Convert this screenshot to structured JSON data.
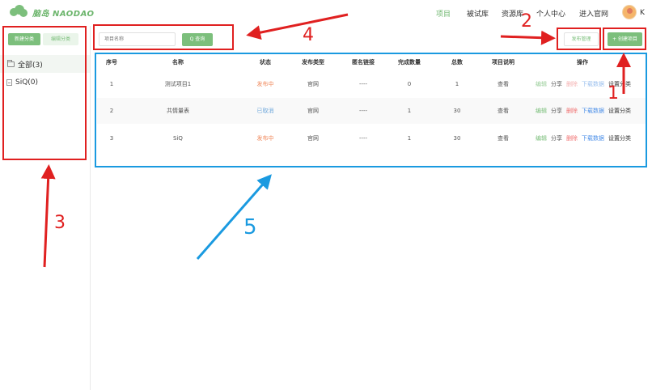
{
  "header": {
    "brand": "脑岛 NAODAO",
    "nav": [
      {
        "label": "项目",
        "active": true
      },
      {
        "label": "被试库"
      },
      {
        "label": "资源库"
      },
      {
        "label": "个人中心"
      },
      {
        "label": "进入官网"
      }
    ],
    "user_initial": "K"
  },
  "sidebar": {
    "new_category": "新建分类",
    "edit_category": "编辑分类",
    "items": [
      {
        "label": "全部(3)",
        "icon": "folder-icon",
        "active": true
      },
      {
        "label": "SiQ(0)",
        "icon": "document-icon"
      }
    ]
  },
  "toolbar": {
    "search_placeholder": "项目名称",
    "search_button": "Q 查询",
    "publish_manage": "发布管理",
    "create_project": "+ 创建项目"
  },
  "table": {
    "headers": [
      "序号",
      "名称",
      "状态",
      "发布类型",
      "匿名链接",
      "完成数量",
      "总数",
      "项目说明",
      "操作"
    ],
    "rows": [
      {
        "index": "1",
        "name": "测试项目1",
        "status": "发布中",
        "status_kind": "published",
        "type": "官网",
        "link": "----",
        "done": "0",
        "total": "1",
        "desc": "查看",
        "ops": [
          "编辑",
          "分享",
          "删除",
          "下载数据",
          "设置分类"
        ],
        "faded": true
      },
      {
        "index": "2",
        "name": "共情量表",
        "status": "已取消",
        "status_kind": "cancelled",
        "type": "官网",
        "link": "----",
        "done": "1",
        "total": "30",
        "desc": "查看",
        "ops": [
          "编辑",
          "分享",
          "删除",
          "下载数据",
          "设置分类"
        ],
        "faded": false
      },
      {
        "index": "3",
        "name": "SiQ",
        "status": "发布中",
        "status_kind": "published",
        "type": "官网",
        "link": "----",
        "done": "1",
        "total": "30",
        "desc": "查看",
        "ops": [
          "编辑",
          "分享",
          "删除",
          "下载数据",
          "设置分类"
        ],
        "faded": false
      }
    ]
  },
  "annotations": {
    "labels": [
      "1",
      "2",
      "3",
      "4",
      "5"
    ],
    "colors": {
      "red": "#e02020",
      "blue": "#1a9ae0"
    }
  },
  "colors": {
    "accent": "#7cbf7c",
    "published": "#f08a5d",
    "cancelled": "#6fa8dc",
    "delete": "#f07070",
    "download": "#4a8ee8"
  }
}
